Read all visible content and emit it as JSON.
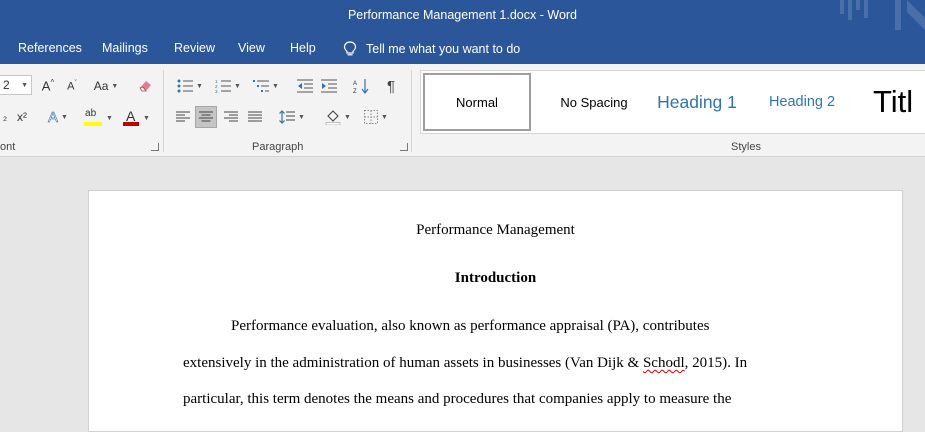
{
  "window": {
    "title": "Performance Management 1.docx  -  Word"
  },
  "tabs": [
    "References",
    "Mailings",
    "Review",
    "View",
    "Help"
  ],
  "tell_me": "Tell me what you want to do",
  "ribbon": {
    "font_size_value": "2",
    "font_group_label": "ont",
    "paragraph_group_label": "Paragraph",
    "styles_group_label": "Styles",
    "change_case": "Aa",
    "subscript": "x₂",
    "superscript": "x²",
    "text_effects": "A",
    "highlight": "ab",
    "font_color": "A",
    "show_marks": "¶"
  },
  "styles": [
    "Normal",
    "No Spacing",
    "Heading 1",
    "Heading 2",
    "Titl"
  ],
  "document": {
    "title": "Performance Management",
    "heading": "Introduction",
    "line1": "Performance evaluation, also known as performance appraisal (PA), contributes",
    "line2_a": "extensively in the administration of human assets in businesses (Van Dijk & ",
    "line2_b": "Schodl",
    "line2_c": ", 2015). In",
    "line3": "particular, this term denotes the means and procedures that companies apply to measure the"
  },
  "colors": {
    "brand": "#2b579a",
    "heading": "#2e74b5",
    "font_color_bar": "#c00000",
    "highlight_bar": "#ffff00"
  }
}
